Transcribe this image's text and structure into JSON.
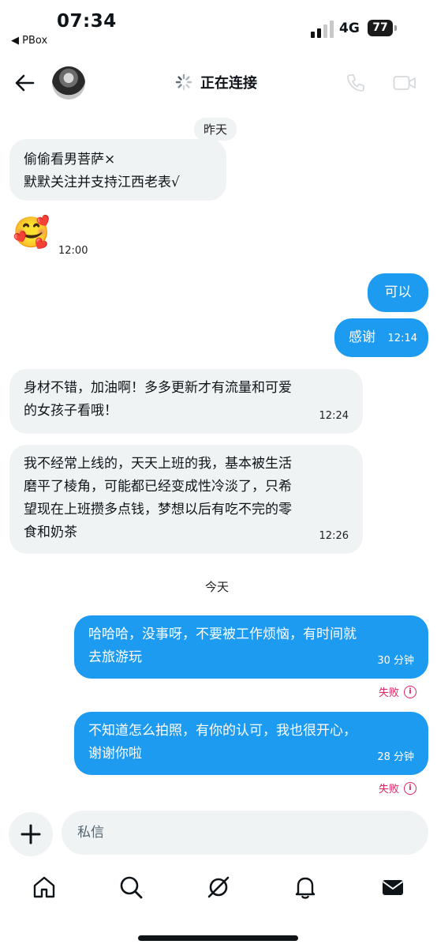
{
  "status_bar": {
    "time": "07:34",
    "back_app": "◀ PBox",
    "network": "4G",
    "battery": "77"
  },
  "header": {
    "connection_status": "正在连接"
  },
  "chat": {
    "date_yesterday": "昨天",
    "msg1": {
      "line1": "偷偷看男菩萨×",
      "line2": "默默关注并支持江西老表√"
    },
    "msg2": {
      "emoji": "🥰",
      "time": "12:00"
    },
    "msg3": {
      "text": "可以"
    },
    "msg4": {
      "text": "感谢",
      "time": "12:14"
    },
    "msg5": {
      "line1": "身材不错，加油啊！多多更新才有流量和可爱",
      "line2": "的女孩子看哦！",
      "time": "12:24"
    },
    "msg6": {
      "line1": "我不经常上线的，天天上班的我，基本被生活",
      "line2": "磨平了棱角，可能都已经变成性冷淡了，只希",
      "line3": "望现在上班攒多点钱，梦想以后有吃不完的零",
      "line4": "食和奶茶",
      "time": "12:26"
    },
    "date_today": "今天",
    "msg7": {
      "line1": "哈哈哈，没事呀，不要被工作烦恼，有时间就",
      "line2": "去旅游玩",
      "time": "30 分钟",
      "failed": "失败"
    },
    "msg8": {
      "line1": "不知道怎么拍照，有你的认可，我也很开心，",
      "line2": "谢谢你啦",
      "time": "28 分钟",
      "failed": "失败"
    }
  },
  "composer": {
    "placeholder": "私信"
  },
  "tabbar": [
    "home-icon",
    "search-icon",
    "grok-icon",
    "notifications-icon",
    "messages-icon"
  ],
  "colors": {
    "accent": "#1d9bf0",
    "bubble_in": "#eff3f4",
    "error": "#e0245e"
  }
}
